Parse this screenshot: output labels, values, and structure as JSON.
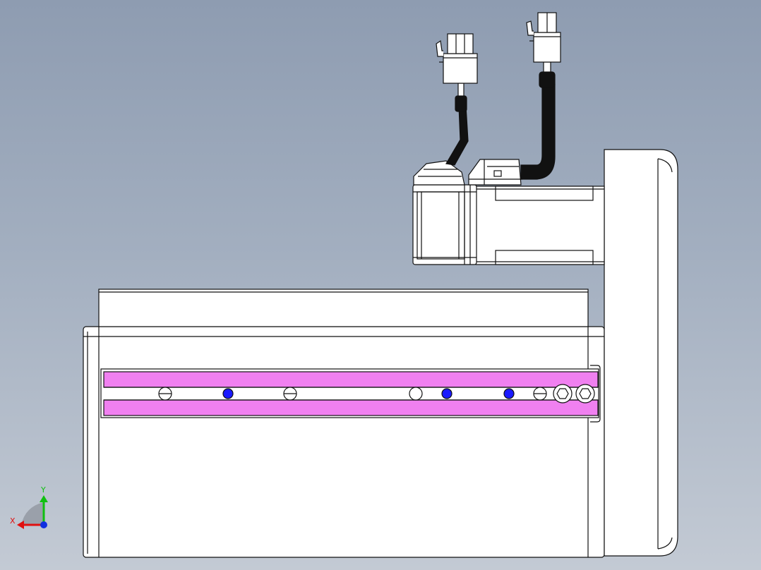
{
  "viewport": {
    "background_top": "#8e9cb1",
    "background_bottom": "#c3cad4"
  },
  "model": {
    "name": "linear-actuator-side-view",
    "body_color": "#ffffff",
    "edge_color": "#111111",
    "slot_highlight_color": "#f080f0",
    "cable_color": "#111111",
    "hole_fill_color": "#1a1aff"
  },
  "triad": {
    "x_label": "X",
    "y_label": "Y",
    "x_color": "#e01010",
    "y_color": "#10c010",
    "z_color": "#1030e0"
  }
}
